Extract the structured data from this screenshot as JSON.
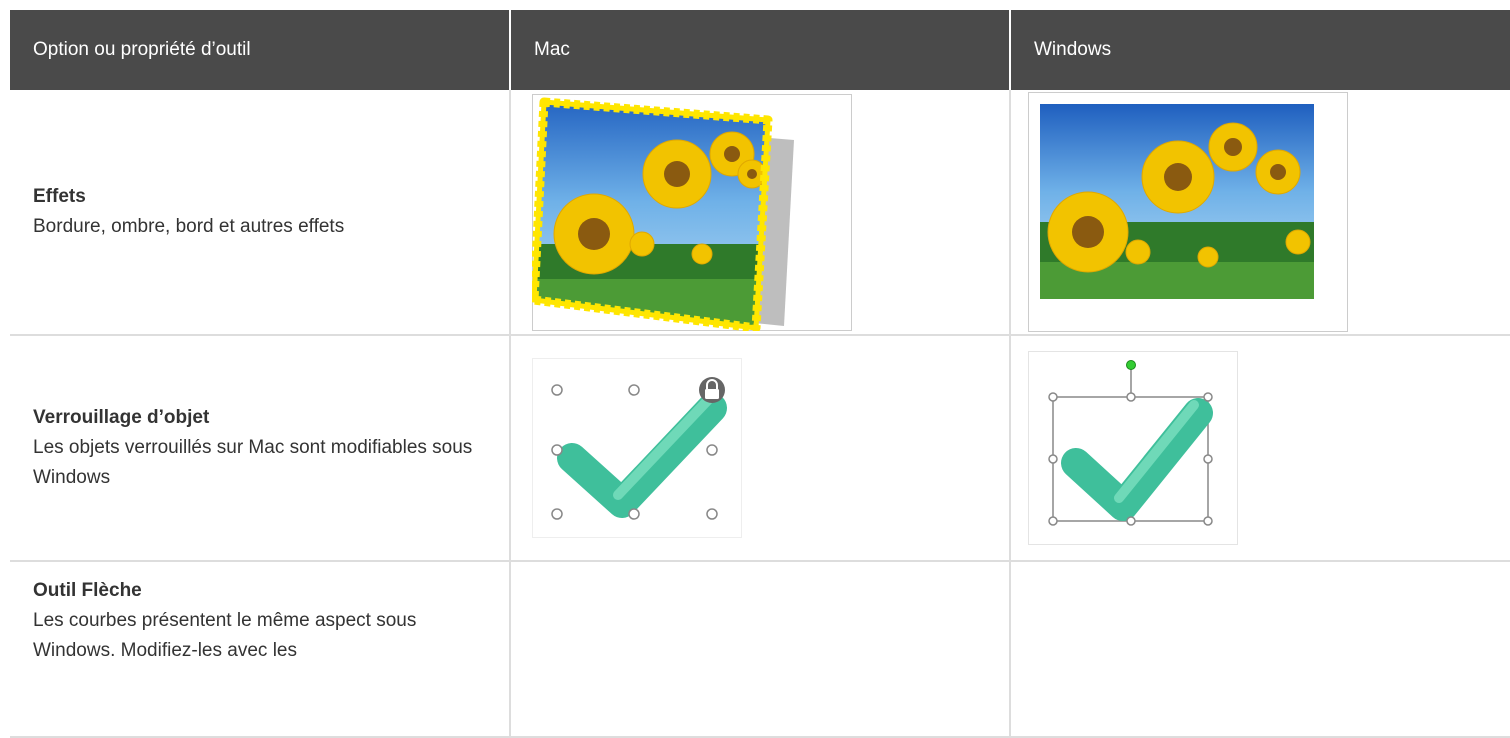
{
  "table": {
    "headers": [
      "Option ou propriété d’outil",
      "Mac",
      "Windows"
    ],
    "rows": [
      {
        "title": "Effets",
        "description": "Bordure, ombre, bord et autres effets"
      },
      {
        "title": "Verrouillage d’objet",
        "description": "Les objets verrouillés sur Mac sont modifiables sous Windows"
      },
      {
        "title": "Outil Flèche",
        "description": "Les courbes présentent le même aspect sous Windows. Modifiez-les avec les"
      }
    ]
  },
  "colors": {
    "header_bg": "#4a4a4a",
    "border": "#dddddd",
    "check": "#3fbf9b",
    "frame_yellow": "#ffe600"
  }
}
